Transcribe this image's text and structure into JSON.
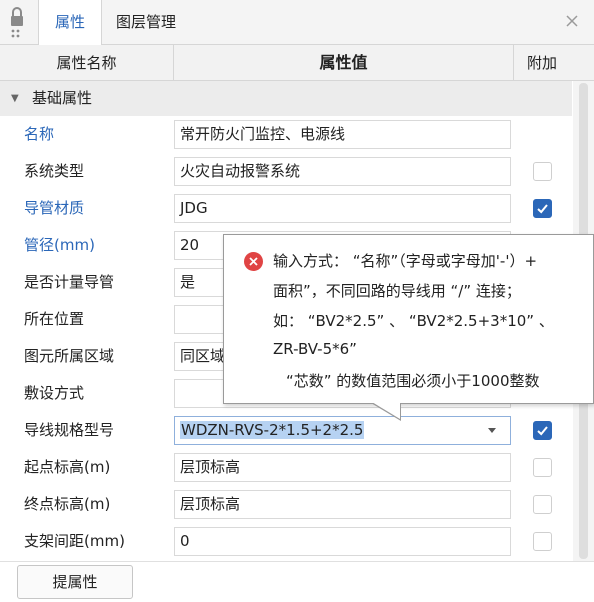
{
  "tabs": {
    "active": "属性",
    "layer": "图层管理"
  },
  "table": {
    "headers": [
      "属性名称",
      "属性值",
      "附加"
    ],
    "group_label": "基础属性",
    "rows": [
      {
        "name": "名称",
        "value": "常开防火门监控、电源线",
        "blue": true,
        "check": null
      },
      {
        "name": "系统类型",
        "value": "火灾自动报警系统",
        "blue": false,
        "check": false
      },
      {
        "name": "导管材质",
        "value": "JDG",
        "blue": true,
        "check": true
      },
      {
        "name": "管径(mm)",
        "value": "20",
        "blue": true,
        "check": null
      },
      {
        "name": "是否计量导管",
        "value": "是",
        "blue": false,
        "check": null
      },
      {
        "name": "所在位置",
        "value": "",
        "blue": false,
        "check": null
      },
      {
        "name": "图元所属区域",
        "value": "同区域",
        "blue": false,
        "check": null
      },
      {
        "name": "敷设方式",
        "value": "",
        "blue": false,
        "check": null
      },
      {
        "name": "导线规格型号",
        "value": "WDZN-RVS-2*1.5+2*2.5",
        "blue": false,
        "check": true
      },
      {
        "name": "起点标高(m)",
        "value": "层顶标高",
        "blue": false,
        "check": false
      },
      {
        "name": "终点标高(m)",
        "value": "层顶标高",
        "blue": false,
        "check": false
      },
      {
        "name": "支架间距(mm)",
        "value": "0",
        "blue": false,
        "check": false
      }
    ]
  },
  "tooltip": {
    "line1": "输入方式：  “名称”（字母或字母加'-'）+",
    "line2": "面积”，不同回路的导线用 “/” 连接；",
    "line3": "如：  “BV2*2.5” 、 “BV2*2.5+3*10” 、",
    "line4": "ZR-BV-5*6”",
    "line5": "“芯数” 的数值范围必须小于1000整数"
  },
  "button": {
    "label": "提属性"
  }
}
